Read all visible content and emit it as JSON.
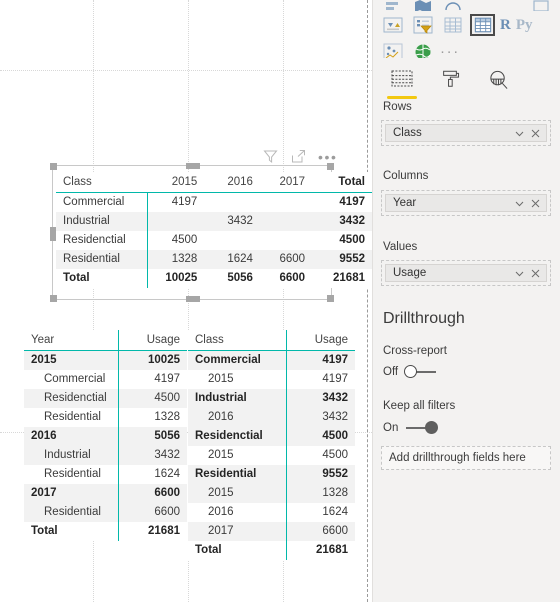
{
  "visual_header": {
    "icons": [
      "filter-icon",
      "focus-mode-icon",
      "more-options-icon"
    ],
    "more_options_label": "•••"
  },
  "matrix_visual": {
    "name": "matrix-by-class-and-year",
    "columns": [
      "Class",
      "2015",
      "2016",
      "2017",
      "Total"
    ],
    "rows": [
      {
        "label": "Commercial",
        "cells": [
          "4197",
          "",
          "",
          "4197"
        ],
        "bold_total": true
      },
      {
        "label": "Industrial",
        "cells": [
          "",
          "3432",
          "",
          "3432"
        ],
        "bold_total": true
      },
      {
        "label": "Residenctial",
        "cells": [
          "4500",
          "",
          "",
          "4500"
        ],
        "bold_total": true
      },
      {
        "label": "Residential",
        "cells": [
          "1328",
          "1624",
          "6600",
          "9552"
        ],
        "bold_total": true
      }
    ],
    "total_row": {
      "label": "Total",
      "cells": [
        "10025",
        "5056",
        "6600",
        "21681"
      ]
    }
  },
  "table_year_usage": {
    "name": "table-year-by-class",
    "columns": [
      "Year",
      "Usage"
    ],
    "rows": [
      {
        "label": "2015",
        "value": "10025",
        "level": 0
      },
      {
        "label": "Commercial",
        "value": "4197",
        "level": 1
      },
      {
        "label": "Residenctial",
        "value": "4500",
        "level": 1
      },
      {
        "label": "Residential",
        "value": "1328",
        "level": 1
      },
      {
        "label": "2016",
        "value": "5056",
        "level": 0
      },
      {
        "label": "Industrial",
        "value": "3432",
        "level": 1
      },
      {
        "label": "Residential",
        "value": "1624",
        "level": 1
      },
      {
        "label": "2017",
        "value": "6600",
        "level": 0
      },
      {
        "label": "Residential",
        "value": "6600",
        "level": 1
      }
    ],
    "total_row": {
      "label": "Total",
      "value": "21681"
    }
  },
  "table_class_usage": {
    "name": "table-class-by-year",
    "columns": [
      "Class",
      "Usage"
    ],
    "rows": [
      {
        "label": "Commercial",
        "value": "4197",
        "level": 0
      },
      {
        "label": "2015",
        "value": "4197",
        "level": 1
      },
      {
        "label": "Industrial",
        "value": "3432",
        "level": 0
      },
      {
        "label": "2016",
        "value": "3432",
        "level": 1
      },
      {
        "label": "Residenctial",
        "value": "4500",
        "level": 0
      },
      {
        "label": "2015",
        "value": "4500",
        "level": 1
      },
      {
        "label": "Residential",
        "value": "9552",
        "level": 0
      },
      {
        "label": "2015",
        "value": "1328",
        "level": 1
      },
      {
        "label": "2016",
        "value": "1624",
        "level": 1
      },
      {
        "label": "2017",
        "value": "6600",
        "level": 1
      }
    ],
    "total_row": {
      "label": "Total",
      "value": "21681"
    }
  },
  "visualizations_pane": {
    "gallery_row1": [
      {
        "name": "card-visual-icon",
        "type": "icon"
      },
      {
        "name": "slicer-visual-icon",
        "type": "icon"
      },
      {
        "name": "table-visual-icon",
        "type": "icon"
      },
      {
        "name": "matrix-visual-icon",
        "type": "icon",
        "selected": true
      },
      {
        "name": "r-script-visual-icon",
        "type": "text",
        "label": "R"
      },
      {
        "name": "python-visual-icon",
        "type": "text",
        "label": "Py"
      }
    ],
    "gallery_row2": [
      {
        "name": "key-influencers-visual-icon",
        "type": "icon"
      },
      {
        "name": "arcgis-maps-visual-icon",
        "type": "icon"
      },
      {
        "name": "get-more-visuals-icon",
        "type": "text",
        "label": "···"
      }
    ],
    "tabs": [
      {
        "name": "fields-tab",
        "icon": "fields-table-icon",
        "selected": true
      },
      {
        "name": "format-tab",
        "icon": "paint-roller-icon",
        "selected": false
      },
      {
        "name": "analytics-tab",
        "icon": "magnifier-icon",
        "selected": false
      }
    ],
    "wells": [
      {
        "label": "Rows",
        "field": "Class",
        "name": "rows-well"
      },
      {
        "label": "Columns",
        "field": "Year",
        "name": "columns-well"
      },
      {
        "label": "Values",
        "field": "Usage",
        "name": "values-well"
      }
    ]
  },
  "drillthrough": {
    "title": "Drillthrough",
    "cross_report": {
      "label": "Cross-report",
      "state": "Off"
    },
    "keep_all_filters": {
      "label": "Keep all filters",
      "state": "On"
    },
    "drop_zone": "Add drillthrough fields here"
  },
  "colors": {
    "accent_teal": "#01b8aa",
    "selected_underline": "#f2c811",
    "pane_bg": "#f3f2f1",
    "alt_row": "#f2f2f2"
  }
}
